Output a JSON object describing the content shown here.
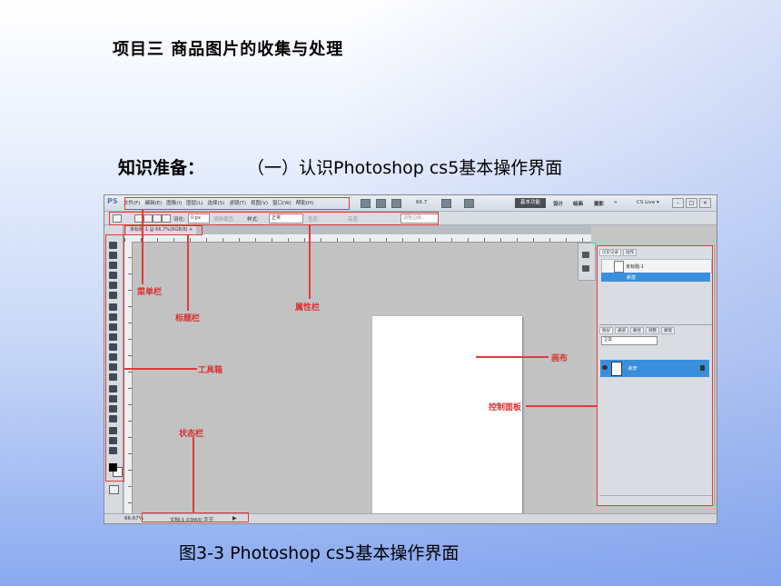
{
  "slide": {
    "title": "项目三   商品图片的收集与处理",
    "knowledge_label": "知识准备：",
    "knowledge_subtitle": "（一）认识Photoshop cs5基本操作界面",
    "caption": "图3-3 Photoshop cs5基本操作界面"
  },
  "photoshop": {
    "logo": "PS",
    "menus": [
      "文件(F)",
      "编辑(E)",
      "图像(I)",
      "图层(L)",
      "选择(S)",
      "滤镜(T)",
      "视图(V)",
      "窗口(W)",
      "帮助(H)"
    ],
    "zoom": "66.7",
    "workspace_active": "基本功能",
    "workspaces": [
      "设计",
      "绘画",
      "摄影",
      "»"
    ],
    "cs_live": "CS Live ▾",
    "window_buttons": [
      "–",
      "□",
      "×"
    ],
    "options": {
      "feather_label": "羽化:",
      "feather_value": "0 px",
      "antialias": "消除锯齿",
      "style_label": "样式:",
      "style_value": "正常",
      "width_label": "宽度:",
      "height_label": "高度:",
      "refine_edge": "调整边缘..."
    },
    "doc_tab": "未标题-1 @ 66.7%(RGB/8) ×",
    "status_zoom": "66.67%",
    "status_doc": "文档:1.03M/0 字节",
    "status_arrow": "▶",
    "panels": {
      "history_tabs": [
        "历史记录",
        "动作"
      ],
      "history_snapshot": "未标题-1",
      "history_state": "新建",
      "layer_tabs": [
        "图层",
        "通道",
        "路径",
        "调整",
        "蒙版"
      ],
      "blend_mode": "正常",
      "layer_name": "背景"
    }
  },
  "annotations": {
    "menubar": "菜单栏",
    "titlebar": "标题栏",
    "options_bar": "属性栏",
    "toolbox": "工具箱",
    "canvas": "画布",
    "panels": "控制面板",
    "statusbar": "状态栏"
  },
  "colors": {
    "annotation_red": "#e03a3a",
    "selection_blue": "#3a8fdc"
  }
}
